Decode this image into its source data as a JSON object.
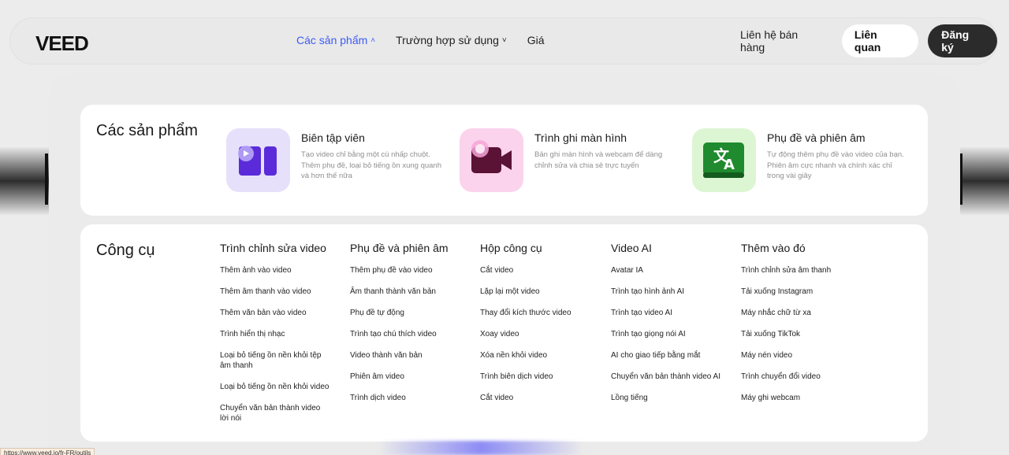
{
  "header": {
    "logo": "VEED",
    "nav": [
      {
        "label": "Các sản phẩm",
        "chevron": "˄",
        "active": true
      },
      {
        "label": "Trường hợp sử dụng",
        "chevron": "˅",
        "active": false
      },
      {
        "label": "Giá",
        "chevron": "",
        "active": false
      }
    ],
    "contact_sales": "Liên hệ bán hàng",
    "login_label": "Liên quan",
    "signup_label": "Đăng ký"
  },
  "products": {
    "title": "Các sản phẩm",
    "items": [
      {
        "name": "Biên tập viên",
        "desc": "Tạo video chỉ bằng một cú nhấp chuột. Thêm phụ đề, loại bỏ tiếng ồn xung quanh và hơn thế nữa",
        "icon": "video-editor-icon",
        "color": "#e6e0fb"
      },
      {
        "name": "Trình ghi màn hình",
        "desc": "Bản ghi màn hình và webcam để dàng chỉnh sửa và chia sẻ trực tuyến",
        "icon": "screen-recorder-icon",
        "color": "#fbd3ec"
      },
      {
        "name": "Phụ đề và phiên âm",
        "desc": "Tự động thêm phụ đề vào video của bạn. Phiên âm cực nhanh và chính xác chỉ trong vài giây",
        "icon": "translate-icon",
        "color": "#dcf6d3"
      }
    ]
  },
  "tools": {
    "title": "Công cụ",
    "columns": [
      {
        "title": "Trình chỉnh sửa video",
        "items": [
          "Thêm ảnh vào video",
          "Thêm âm thanh vào video",
          "Thêm văn bản vào video",
          "Trình hiển thị nhạc",
          "Loại bỏ tiếng ồn nền khỏi tệp âm thanh",
          "Loại bỏ tiếng ồn nền khỏi video",
          "Chuyển văn bản thành video lời nói"
        ]
      },
      {
        "title": "Phụ đề và phiên âm",
        "items": [
          "Thêm phụ đề vào video",
          "Âm thanh thành văn bản",
          "Phụ đề tự động",
          "Trình tạo chú thích video",
          "Video thành văn bản",
          "Phiên âm video",
          "Trình dịch video"
        ]
      },
      {
        "title": "Hộp công cụ",
        "items": [
          "Cắt video",
          "Lặp lại một video",
          "Thay đổi kích thước video",
          "Xoay video",
          "Xóa nền khỏi video",
          "Trình biên dịch video",
          "Cắt video"
        ]
      },
      {
        "title": "Video AI",
        "items": [
          "Avatar IA",
          "Trình tạo hình ảnh AI",
          "Trình tạo video AI",
          "Trình tạo giọng nói AI",
          "AI cho giao tiếp bằng mắt",
          "Chuyển văn bản thành video AI",
          "Lồng tiếng"
        ]
      },
      {
        "title": "Thêm vào đó",
        "items": [
          "Trình chỉnh sửa âm thanh",
          "Tải xuống Instagram",
          "Máy nhắc chữ từ xa",
          "Tải xuống TikTok",
          "Máy nén video",
          "Trình chuyển đổi video",
          "Máy ghi webcam"
        ]
      }
    ]
  },
  "status_url": "https://www.veed.io/fr-FR/outils"
}
